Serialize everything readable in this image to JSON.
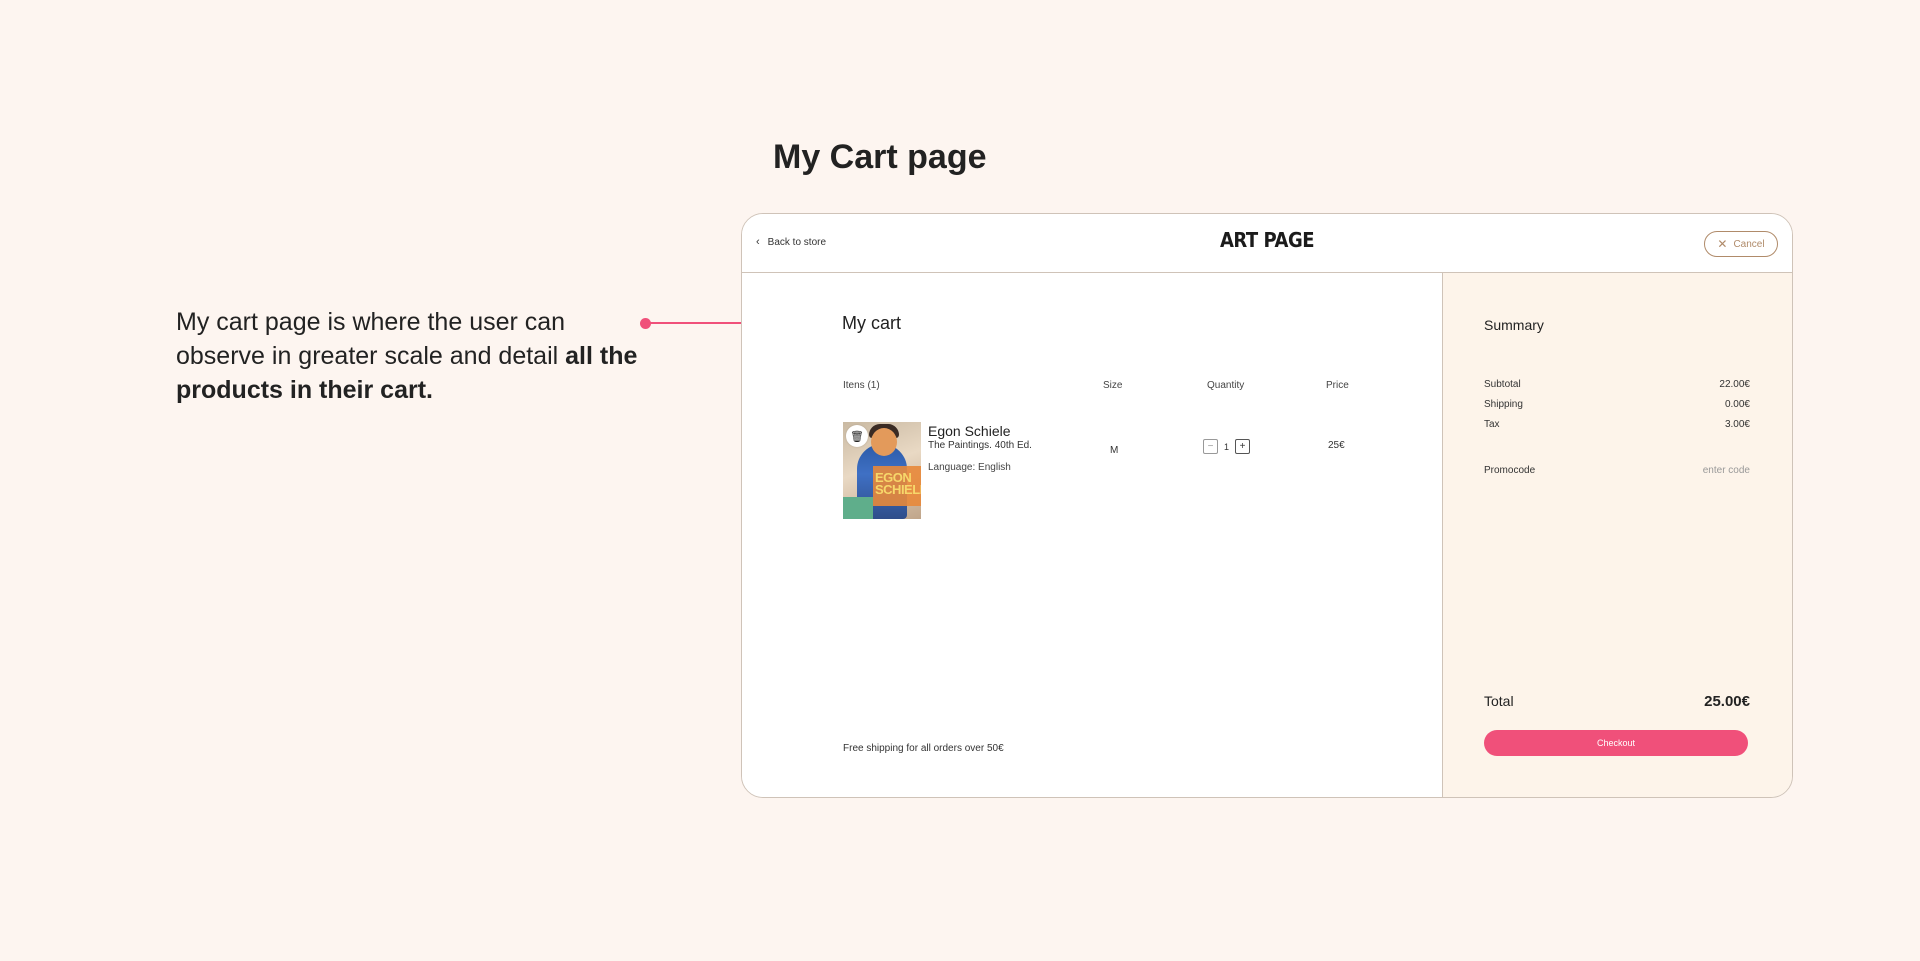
{
  "page": {
    "heading": "My Cart page",
    "description_normal": "My cart page is where the user can observe in greater scale and detail",
    "description_bold": "all the products in their cart."
  },
  "topbar": {
    "back_label": "Back to store",
    "logo": "ART PAGE",
    "cancel_label": "Cancel"
  },
  "cart": {
    "title": "My cart",
    "columns": {
      "items": "Itens (1)",
      "size": "Size",
      "quantity": "Quantity",
      "price": "Price"
    },
    "items": [
      {
        "name": "Egon Schiele",
        "subtitle": "The Paintings. 40th Ed.",
        "language": "Language: English",
        "size": "M",
        "quantity": "1",
        "price": "25€",
        "cover_text": "EGON SCHIELE"
      }
    ],
    "free_shipping_note": "Free shipping for all orders over 50€"
  },
  "summary": {
    "title": "Summary",
    "subtotal_label": "Subtotal",
    "subtotal_value": "22.00€",
    "shipping_label": "Shipping",
    "shipping_value": "0.00€",
    "tax_label": "Tax",
    "tax_value": "3.00€",
    "promocode_label": "Promocode",
    "promocode_placeholder": "enter code",
    "total_label": "Total",
    "total_value": "25.00€",
    "checkout_label": "Checkout"
  },
  "colors": {
    "background": "#fdf5f0",
    "accent": "#f0507a",
    "cancel_border": "#b08b6a",
    "summary_bg": "#fdf4ea"
  }
}
